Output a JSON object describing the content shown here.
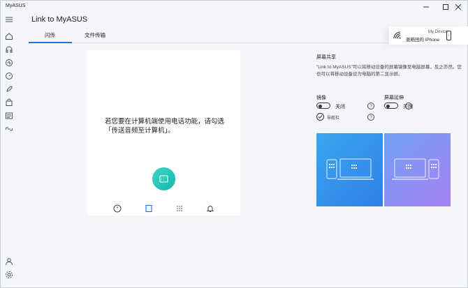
{
  "app": {
    "title": "MyASUS"
  },
  "header": {
    "title": "Link to MyASUS"
  },
  "tabs": [
    {
      "label": "闪传"
    },
    {
      "label": "文件传输"
    }
  ],
  "device": {
    "label": "My Device",
    "name": "姜皓田的 iPhone"
  },
  "phone": {
    "message": "若您要在计算机端使用电话功能，请勾选「传送音频至计算机」。"
  },
  "screen_share": {
    "title": "屏幕共享",
    "description": "\"Link to MyASUS\"可以将移动设备的屏幕镜像至电脑屏幕，反之亦然。您也可以将移动设备设为电脑的第二显示屏。",
    "mirror": {
      "label": "镜像",
      "state": "关闭"
    },
    "extend": {
      "label": "屏幕延伸",
      "state": "关闭"
    },
    "nav_bar": {
      "label": "导航栏"
    }
  },
  "colors": {
    "accent": "#1b6fd8",
    "call": "#22c1b8"
  }
}
